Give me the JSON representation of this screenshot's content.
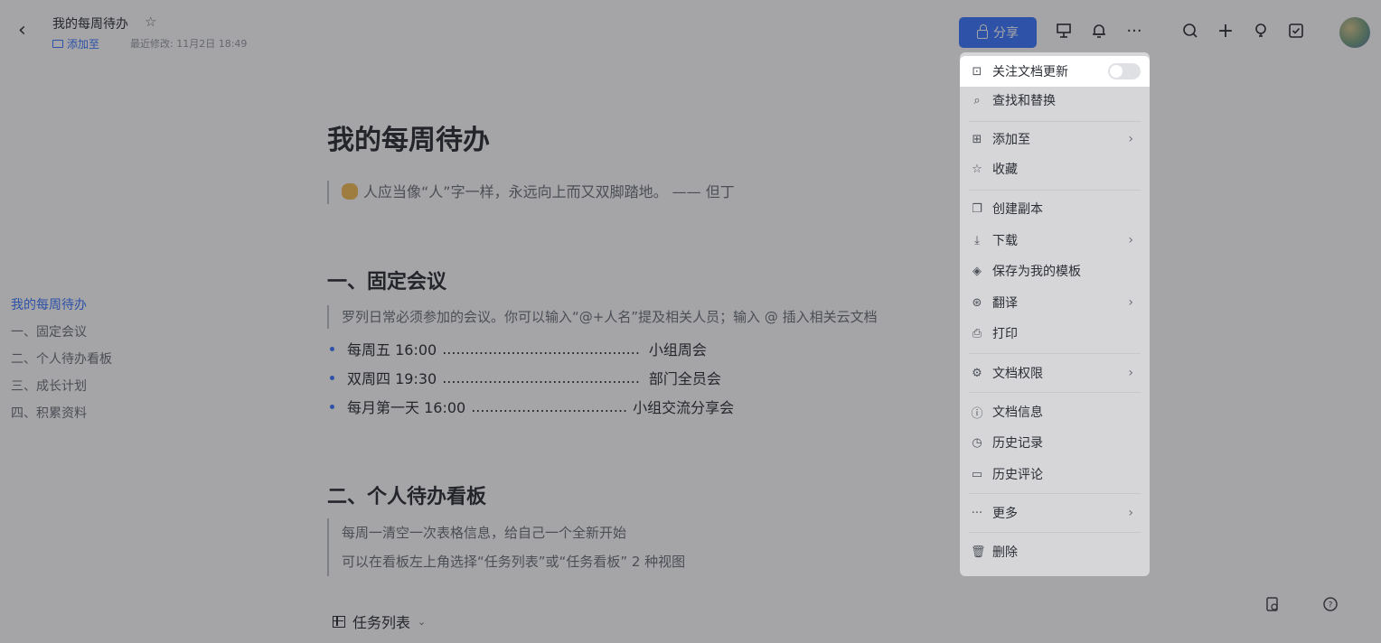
{
  "header": {
    "doc_title": "我的每周待办",
    "add_to_label": "添加至",
    "last_modified": "最近修改: 11月2日 18:49",
    "share_label": "分享"
  },
  "outline": {
    "items": [
      "我的每周待办",
      "一、固定会议",
      "二、个人待办看板",
      "三、成长计划",
      "四、积累资料"
    ]
  },
  "document": {
    "title": "我的每周待办",
    "quote": "人应当像“人”字一样，永远向上而又双脚踏地。 —— 但丁",
    "section1": {
      "heading": "一、固定会议",
      "note": "罗列日常必须参加的会议。你可以输入“@+人名”提及相关人员；输入 @ 插入相关云文档",
      "meetings": [
        {
          "time": "每周五 16:00",
          "dots": "...........................................",
          "name": "小组周会"
        },
        {
          "time": "双周四 19:30",
          "dots": "...........................................",
          "name": "部门全员会"
        },
        {
          "time": "每月第一天 16:00",
          "dots": "..................................",
          "name": "小组交流分享会"
        }
      ]
    },
    "section2": {
      "heading": "二、个人待办看板",
      "note1": "每周一清空一次表格信息，给自己一个全新开始",
      "note2": "可以在看板左上角选择“任务列表”或“任务看板” 2 种视图",
      "view_label": "任务列表"
    }
  },
  "menu": {
    "items": [
      {
        "label": "关注文档更新",
        "icon": "subscribe-icon",
        "toggle": false
      },
      {
        "label": "查找和替换",
        "icon": "find-replace-icon"
      },
      {
        "label": "添加至",
        "icon": "add-to-icon",
        "submenu": true
      },
      {
        "label": "收藏",
        "icon": "star-icon"
      },
      {
        "label": "创建副本",
        "icon": "copy-icon"
      },
      {
        "label": "下载",
        "icon": "download-icon",
        "submenu": true
      },
      {
        "label": "保存为我的模板",
        "icon": "template-icon"
      },
      {
        "label": "翻译",
        "icon": "translate-icon",
        "submenu": true
      },
      {
        "label": "打印",
        "icon": "print-icon"
      },
      {
        "label": "文档权限",
        "icon": "settings-icon",
        "submenu": true
      },
      {
        "label": "文档信息",
        "icon": "info-icon"
      },
      {
        "label": "历史记录",
        "icon": "history-icon"
      },
      {
        "label": "历史评论",
        "icon": "comment-history-icon"
      },
      {
        "label": "更多",
        "icon": "more-icon",
        "submenu": true
      },
      {
        "label": "删除",
        "icon": "trash-icon"
      }
    ]
  },
  "colors": {
    "accent": "#3370ff",
    "text": "#1f2329",
    "muted": "#646a73"
  }
}
